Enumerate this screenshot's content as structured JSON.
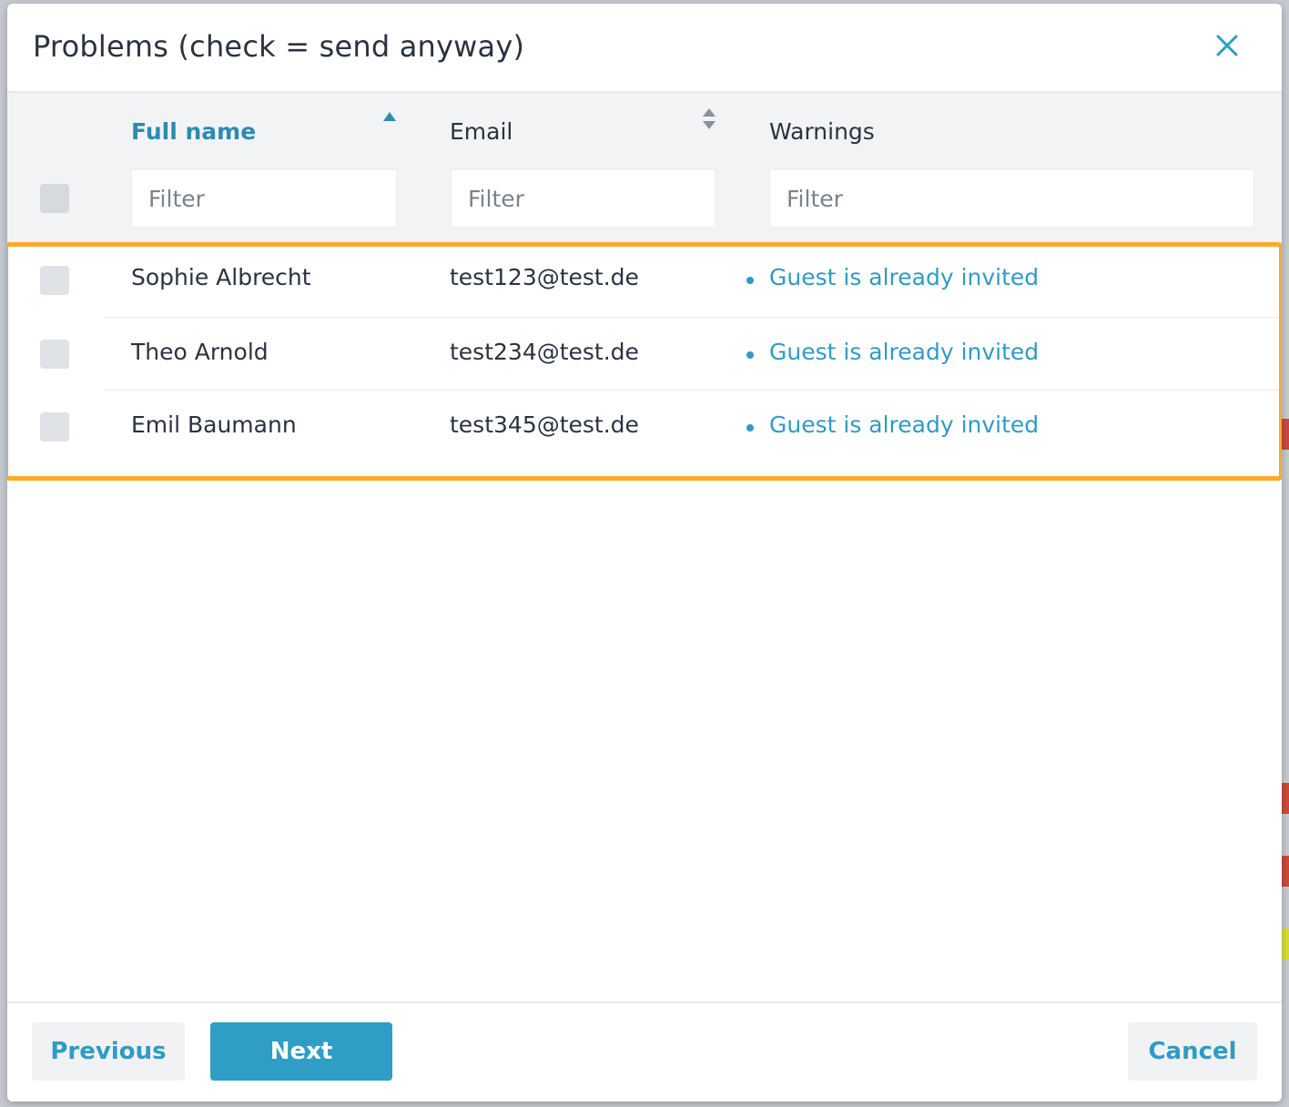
{
  "dialog": {
    "title": "Problems (check = send anyway)",
    "close_icon": "close-icon"
  },
  "table": {
    "columns": {
      "full_name": "Full name",
      "email": "Email",
      "warnings": "Warnings"
    },
    "sort": {
      "column": "Full name",
      "direction": "ascending"
    },
    "filters": {
      "full_name_placeholder": "Filter",
      "email_placeholder": "Filter",
      "warnings_placeholder": "Filter"
    },
    "rows": [
      {
        "name": "Sophie Albrecht",
        "email": "test123@test.de",
        "warning": "Guest is already invited",
        "checked": false
      },
      {
        "name": "Theo Arnold",
        "email": "test234@test.de",
        "warning": "Guest is already invited",
        "checked": false
      },
      {
        "name": "Emil Baumann",
        "email": "test345@test.de",
        "warning": "Guest is already invited",
        "checked": false
      }
    ]
  },
  "footer": {
    "previous_label": "Previous",
    "next_label": "Next",
    "cancel_label": "Cancel"
  },
  "colors": {
    "accent": "#2f9ec6",
    "highlight": "#fbaa2a",
    "text": "#2a3340"
  }
}
